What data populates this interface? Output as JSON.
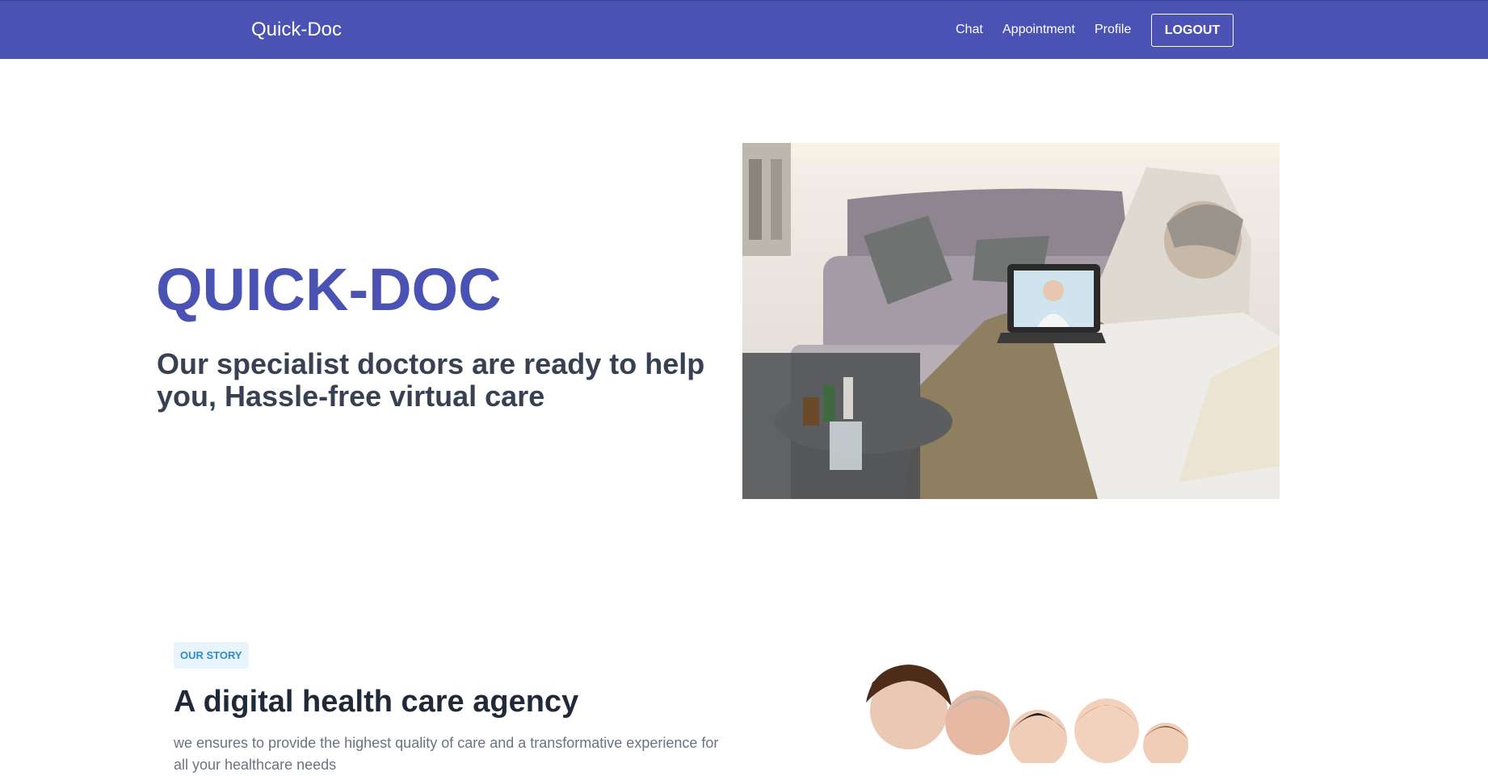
{
  "nav": {
    "brand": "Quick-Doc",
    "links": [
      "Chat",
      "Appointment",
      "Profile"
    ],
    "logout_label": "LOGOUT"
  },
  "hero": {
    "title": "QUICK-DOC",
    "subtitle": "Our specialist doctors are ready to help you, Hassle-free virtual care"
  },
  "story": {
    "badge": "OUR STORY",
    "title": "A digital health care agency",
    "text": "we ensures to provide the highest quality of care and a transformative experience for all your healthcare needs"
  },
  "colors": {
    "brand": "#4a52b3",
    "heading": "#374151",
    "badge_bg": "#e8f4fb",
    "badge_text": "#2e8ccf"
  }
}
